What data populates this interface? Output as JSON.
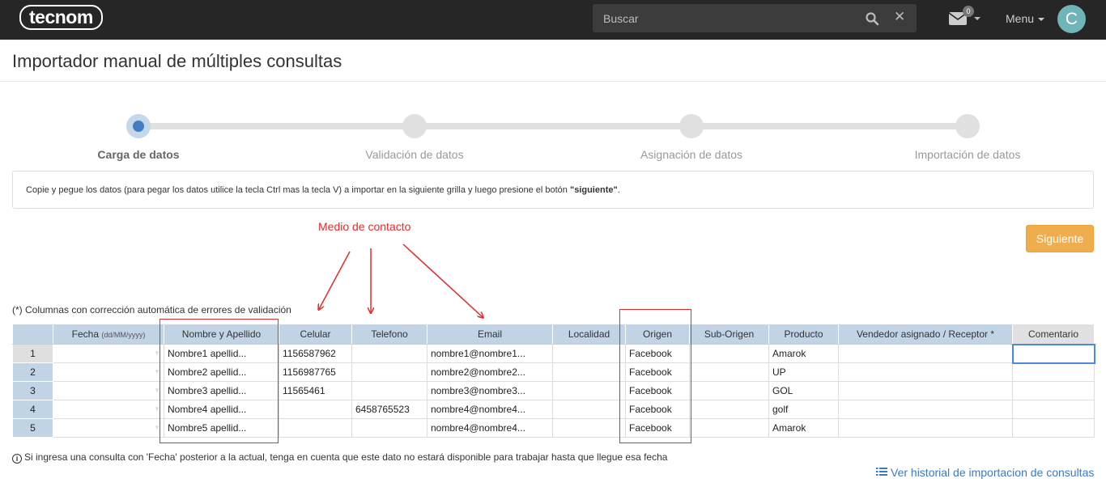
{
  "brand": {
    "logo_text": "tecnom"
  },
  "topbar": {
    "search_placeholder": "Buscar",
    "mail_count": "0",
    "menu_label": "Menu",
    "avatar_initial": "C"
  },
  "page": {
    "title": "Importador manual de múltiples consultas"
  },
  "stepper": {
    "steps": [
      {
        "label": "Carga de datos",
        "active": true
      },
      {
        "label": "Validación de datos",
        "active": false
      },
      {
        "label": "Asignación de datos",
        "active": false
      },
      {
        "label": "Importación de datos",
        "active": false
      }
    ]
  },
  "instructions": {
    "text_before": "Copie y pegue los datos (para pegar los datos utilice la tecla Ctrl mas la tecla V) a importar en la siguiente grilla y luego presione el botón ",
    "highlight": "\"siguiente\"",
    "text_after": "."
  },
  "annotation": {
    "label": "Medio de contacto"
  },
  "actions": {
    "next_label": "Siguiente"
  },
  "grid_note": "(*) Columnas con corrección automática de errores de validación",
  "grid": {
    "headers": {
      "fecha": "Fecha",
      "fecha_format": "(dd/MM/yyyy)",
      "nombre": "Nombre y Apellido",
      "celular": "Celular",
      "telefono": "Telefono",
      "email": "Email",
      "localidad": "Localidad",
      "origen": "Origen",
      "suborigen": "Sub-Origen",
      "producto": "Producto",
      "vendedor": "Vendedor asignado / Receptor *",
      "comentario": "Comentario"
    },
    "rows": [
      {
        "n": "1",
        "fecha": "",
        "nombre": "Nombre1 apellid...",
        "celular": "1156587962",
        "telefono": "",
        "email": "nombre1@nombre1...",
        "localidad": "",
        "origen": "Facebook",
        "suborigen": "",
        "producto": "Amarok",
        "vendedor": "",
        "comentario": ""
      },
      {
        "n": "2",
        "fecha": "",
        "nombre": "Nombre2 apellid...",
        "celular": "1156987765",
        "telefono": "",
        "email": "nombre2@nombre2...",
        "localidad": "",
        "origen": "Facebook",
        "suborigen": "",
        "producto": "UP",
        "vendedor": "",
        "comentario": ""
      },
      {
        "n": "3",
        "fecha": "",
        "nombre": "Nombre3 apellid...",
        "celular": "11565461",
        "telefono": "",
        "email": "nombre3@nombre3...",
        "localidad": "",
        "origen": "Facebook",
        "suborigen": "",
        "producto": "GOL",
        "vendedor": "",
        "comentario": ""
      },
      {
        "n": "4",
        "fecha": "",
        "nombre": "Nombre4 apellid...",
        "celular": "",
        "telefono": "6458765523",
        "email": "nombre4@nombre4...",
        "localidad": "",
        "origen": "Facebook",
        "suborigen": "",
        "producto": "golf",
        "vendedor": "",
        "comentario": ""
      },
      {
        "n": "5",
        "fecha": "",
        "nombre": "Nombre5 apellid...",
        "celular": "",
        "telefono": "",
        "email": "nombre4@nombre4...",
        "localidad": "",
        "origen": "Facebook",
        "suborigen": "",
        "producto": "Amarok",
        "vendedor": "",
        "comentario": ""
      }
    ]
  },
  "footer": {
    "note": "Si ingresa una consulta con 'Fecha' posterior a la actual, tenga en cuenta que este dato no estará disponible para trabajar hasta que llegue esa fecha",
    "history_link": "Ver historial de importacion de consultas"
  }
}
